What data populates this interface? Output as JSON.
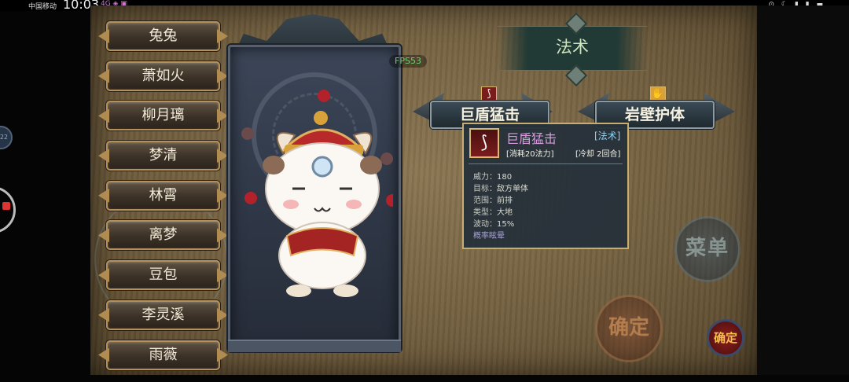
{
  "status_bar": {
    "carrier": "中国移动",
    "time": "10:03",
    "left_icons": "4G ◈ ▣",
    "right_icons": "⊙ ☾ ▮ ▮ ▬"
  },
  "fps": "FPS53",
  "characters": [
    "兔兔",
    "萧如火",
    "柳月璃",
    "梦清",
    "林霄",
    "离梦",
    "豆包",
    "李灵溪",
    "雨薇"
  ],
  "skill_header": "法术",
  "skills": [
    {
      "name": "巨盾猛击",
      "icon": "claw-icon"
    },
    {
      "name": "岩壁护体",
      "icon": "shield-hand-icon"
    }
  ],
  "tooltip": {
    "name": "巨盾猛击",
    "type": "[法术]",
    "cost": "[消耗20法力]",
    "cooldown": "[冷却 2回合]",
    "stats": [
      {
        "k": "威力：",
        "v": "180"
      },
      {
        "k": "目标：",
        "v": "敌方单体"
      },
      {
        "k": "范围：",
        "v": "前排"
      },
      {
        "k": "类型：",
        "v": "大地"
      },
      {
        "k": "波动：",
        "v": "15%"
      }
    ],
    "extra": "概率眩晕"
  },
  "buttons": {
    "menu": "菜单",
    "confirm_big": "确定",
    "confirm_small": "确定"
  },
  "overlay": {
    "float_label": "22"
  },
  "colors": {
    "accent_gold": "#b4915a",
    "tooltip_name": "#d89be0",
    "tooltip_type": "#8fd0f0",
    "fps_green": "#6fd26f"
  }
}
